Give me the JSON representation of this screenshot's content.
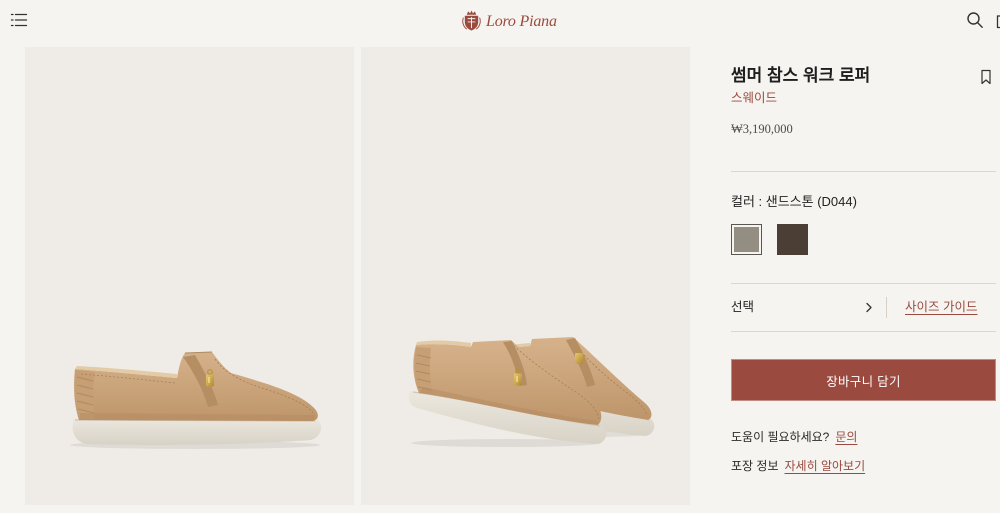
{
  "header": {
    "menu_icon": "menu-icon",
    "logo_icon": "crest-icon",
    "logo_text": "Loro Piana",
    "search_icon": "search-icon",
    "bag_icon": "bag-icon"
  },
  "product": {
    "title": "썸머 참스 워크 로퍼",
    "material": "스웨이드",
    "price": "₩3,190,000",
    "wishlist_icon": "bookmark-icon"
  },
  "color": {
    "label": "컬러 : 샌드스톤 (D044)",
    "swatches": [
      {
        "color": "#948d81",
        "selected": true
      },
      {
        "color": "#4a3e35",
        "selected": false
      }
    ]
  },
  "size": {
    "select_label": "선택",
    "chevron_icon": "chevron-right-icon",
    "guide_link": "사이즈 가이드"
  },
  "cart": {
    "button_label": "장바구니 담기"
  },
  "help": {
    "question": "도움이 필요하세요?",
    "link": "문의"
  },
  "packaging": {
    "label": "포장 정보",
    "link": "자세히 알아보기"
  },
  "theme": {
    "accent": "#9b4a3f"
  }
}
